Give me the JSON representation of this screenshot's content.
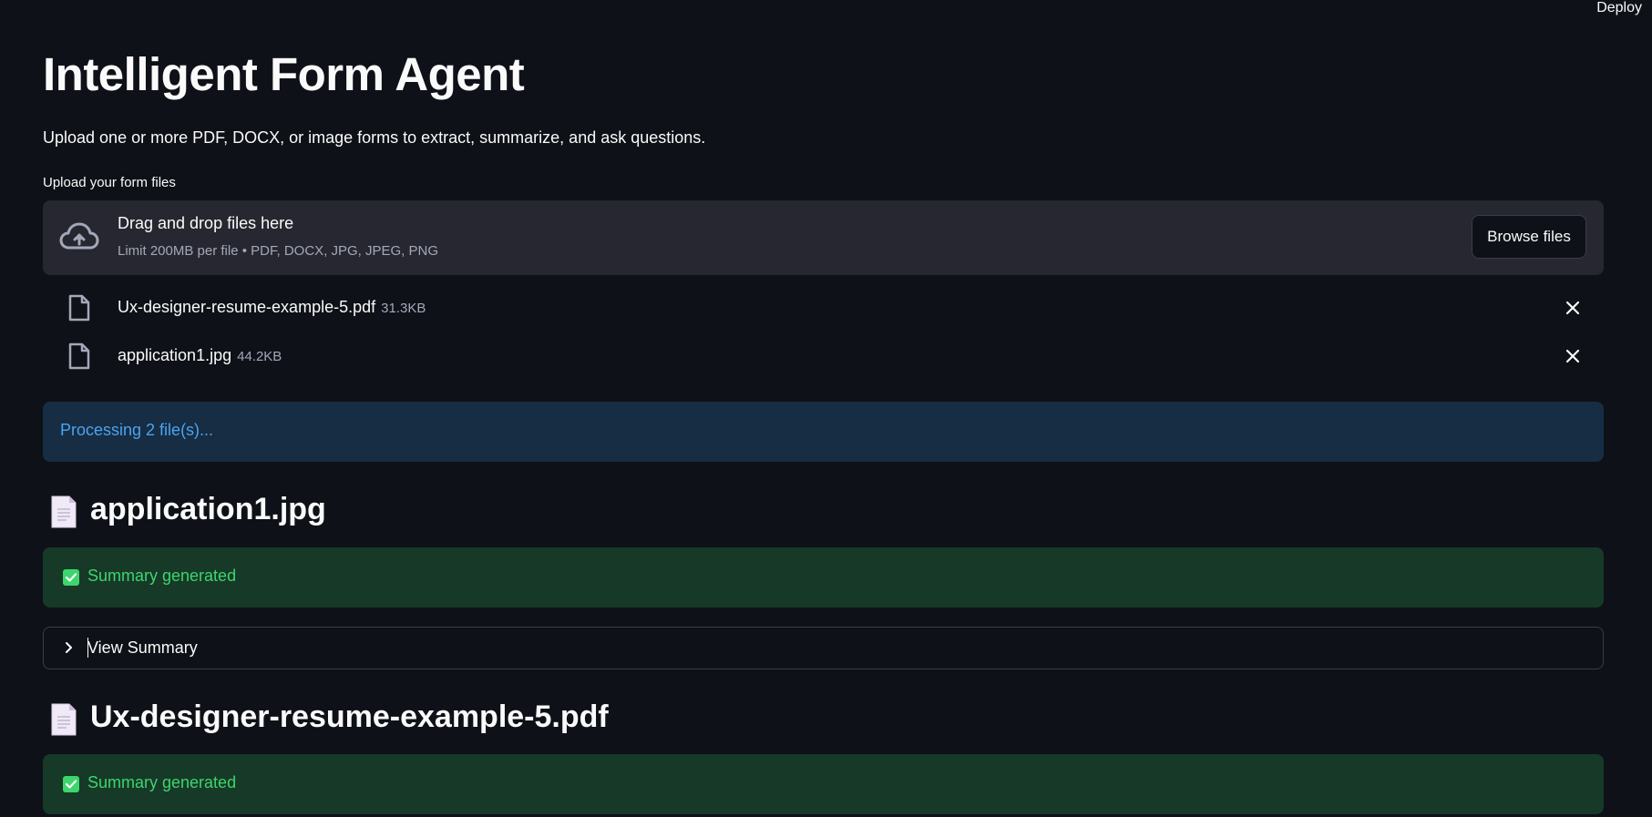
{
  "header": {
    "deploy_label": "Deploy"
  },
  "page": {
    "title": "Intelligent Form Agent",
    "subtitle": "Upload one or more PDF, DOCX, or image forms to extract, summarize, and ask questions."
  },
  "uploader": {
    "label": "Upload your form files",
    "drop_title": "Drag and drop files here",
    "limit_text": "Limit 200MB per file • PDF, DOCX, JPG, JPEG, PNG",
    "browse_label": "Browse files",
    "files": [
      {
        "name": "Ux-designer-resume-example-5.pdf",
        "size": "31.3KB"
      },
      {
        "name": "application1.jpg",
        "size": "44.2KB"
      }
    ]
  },
  "status": {
    "processing_text": "Processing 2 file(s)..."
  },
  "results": [
    {
      "title": "application1.jpg",
      "success_text": "Summary generated",
      "expander_label": "View Summary"
    },
    {
      "title": "Ux-designer-resume-example-5.pdf",
      "success_text": "Summary generated"
    }
  ],
  "colors": {
    "background": "#0e1117",
    "info_bg": "#172d43",
    "info_text": "#4aa3f0",
    "success_bg": "#173928",
    "success_text": "#3dd56d"
  },
  "icons": {
    "upload": "cloud-upload-icon",
    "file": "file-icon",
    "remove": "close-icon",
    "document": "page-facing-up-icon",
    "success": "check-box-icon",
    "expand": "chevron-right-icon"
  }
}
